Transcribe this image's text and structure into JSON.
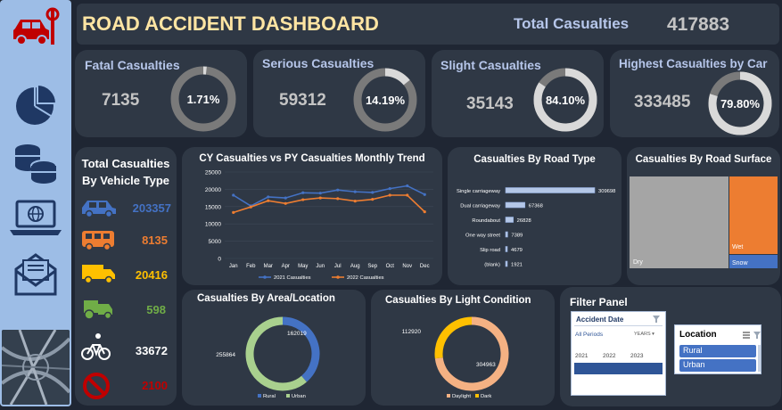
{
  "header": {
    "title": "ROAD ACCIDENT DASHBOARD",
    "total_label": "Total Casualties",
    "total_value": "417883"
  },
  "colors": {
    "bg": "#1f2633",
    "card": "#2f3845",
    "sidebar": "#9dbde6",
    "accent_blue": "#4472c4",
    "accent_orange": "#ed7d31",
    "title_yellow": "#ffe5a3",
    "gauge": "#808080"
  },
  "sidebar": {
    "icons": [
      "car-crash-icon",
      "pie-chart-icon",
      "coins-icon",
      "laptop-globe-icon",
      "envelope-icon",
      "road-photo"
    ]
  },
  "kpis": [
    {
      "label": "Fatal Casualties",
      "value": "7135",
      "percent_text": "1.71%",
      "percent": 1.71
    },
    {
      "label": "Serious Casualties",
      "value": "59312",
      "percent_text": "14.19%",
      "percent": 14.19
    },
    {
      "label": "Slight Casualties",
      "value": "35143",
      "percent_text": "84.10%",
      "percent": 84.1
    },
    {
      "label": "Highest Casualties by Car",
      "value": "333485",
      "percent_text": "79.80%",
      "percent": 79.8
    }
  ],
  "vehicle": {
    "title_line1": "Total Casualties",
    "title_line2": "By Vehicle Type",
    "items": [
      {
        "icon": "car-icon",
        "value": "203357",
        "color": "#4472c4"
      },
      {
        "icon": "bus-icon",
        "value": "8135",
        "color": "#ed7d31"
      },
      {
        "icon": "truck-icon",
        "value": "20416",
        "color": "#ffc000"
      },
      {
        "icon": "agri-vehicle-icon",
        "value": "598",
        "color": "#70ad47"
      },
      {
        "icon": "bicycle-icon",
        "value": "33672",
        "color": "#ffffff"
      },
      {
        "icon": "no-entry-icon",
        "value": "2100",
        "color": "#c00000"
      }
    ]
  },
  "trend": {
    "title": "CY Casualties vs PY Casualties Monthly Trend"
  },
  "road_type": {
    "title": "Casualties By Road Type"
  },
  "road_surface": {
    "title": "Casualties By Road Surface",
    "labels": [
      "Dry",
      "Wet",
      "Snow"
    ]
  },
  "area": {
    "title": "Casualties By Area/Location"
  },
  "light": {
    "title": "Casualties By Light Condition"
  },
  "filter": {
    "title": "Filter Panel",
    "date_slicer": {
      "title": "Accident Date",
      "period": "All Periods",
      "unit": "YEARS",
      "years": [
        "2021",
        "2022",
        "2023"
      ]
    },
    "location_slicer": {
      "title": "Location",
      "options": [
        "Rural",
        "Urban"
      ]
    }
  },
  "chart_data": [
    {
      "type": "line",
      "title": "CY Casualties vs PY Casualties Monthly Trend",
      "categories": [
        "Jan",
        "Feb",
        "Mar",
        "Apr",
        "May",
        "Jun",
        "Jul",
        "Aug",
        "Sep",
        "Oct",
        "Nov",
        "Dec"
      ],
      "yticks": [
        "0",
        "5000",
        "10000",
        "15000",
        "20000",
        "25000"
      ],
      "ylim": [
        0,
        25000
      ],
      "series": [
        {
          "name": "2021 Casualties",
          "color": "#4472c4",
          "values": [
            18300,
            15200,
            17800,
            17500,
            19000,
            18900,
            19800,
            19300,
            19100,
            20200,
            21000,
            18500
          ]
        },
        {
          "name": "2022 Casualties",
          "color": "#ed7d31",
          "values": [
            13300,
            14900,
            16700,
            15900,
            17000,
            17500,
            17300,
            16600,
            17100,
            18300,
            18300,
            13500
          ]
        }
      ],
      "legend": "bottom"
    },
    {
      "type": "bar",
      "title": "Casualties By Road Type",
      "categories": [
        "Single carriageway",
        "Dual carriageway",
        "Roundabout",
        "One way street",
        "Slip road",
        "(blank)"
      ],
      "values": [
        309698,
        67368,
        26828,
        7389,
        4679,
        1921
      ],
      "labels": [
        "309698",
        "67368",
        "26828",
        "7389",
        "4679",
        "1921"
      ]
    },
    {
      "type": "heatmap",
      "title": "Casualties By Road Surface",
      "categories": [
        "Dry",
        "Wet",
        "Snow"
      ],
      "values": [
        279445,
        115261,
        6500
      ]
    },
    {
      "type": "pie",
      "title": "Casualties By Area/Location",
      "categories": [
        "Rural",
        "Urban"
      ],
      "values": [
        162019,
        255864
      ],
      "labels": [
        "162019",
        "255864"
      ],
      "legend": "bottom"
    },
    {
      "type": "pie",
      "title": "Casualties By Light Condition",
      "categories": [
        "Daylight",
        "Dark"
      ],
      "values": [
        304963,
        112920
      ],
      "labels": [
        "304963",
        "112920"
      ],
      "legend": "bottom"
    }
  ]
}
